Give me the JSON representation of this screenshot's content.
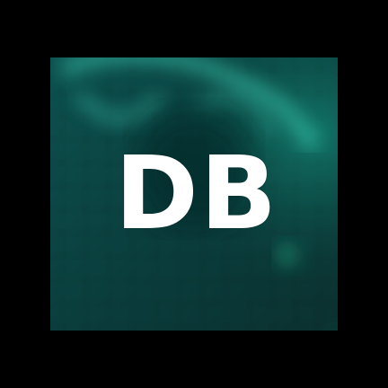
{
  "icon": {
    "text": "DB",
    "colors": {
      "background": "#000000",
      "tile": "#0a3b3a",
      "tile_light": "#0f6f63",
      "glow": "#35d6a0",
      "text": "#ffffff"
    }
  }
}
